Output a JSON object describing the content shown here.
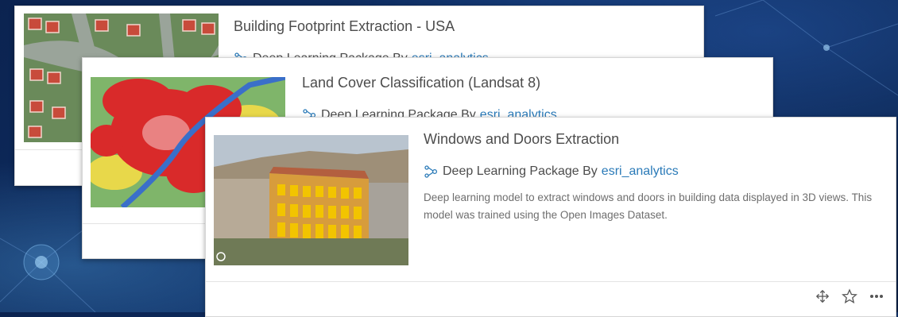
{
  "cards": [
    {
      "title": "Building Footprint Extraction - USA",
      "package_label": "Deep Learning Package By",
      "owner": "esri_analytics"
    },
    {
      "title": "Land Cover Classification (Landsat 8)",
      "package_label": "Deep Learning Package By",
      "owner": "esri_analytics"
    },
    {
      "title": "Windows and Doors Extraction",
      "package_label": "Deep Learning Package By",
      "owner": "esri_analytics",
      "description": "Deep learning model to extract windows and doors in building data displayed in 3D views. This model was trained using the Open Images Dataset."
    }
  ],
  "icons": {
    "package": "deep-learning-package-icon",
    "move": "move-icon",
    "favorite": "star-icon",
    "more": "more-options-icon"
  },
  "colors": {
    "owner_link": "#2a7ab8",
    "background": "#0f3066"
  }
}
